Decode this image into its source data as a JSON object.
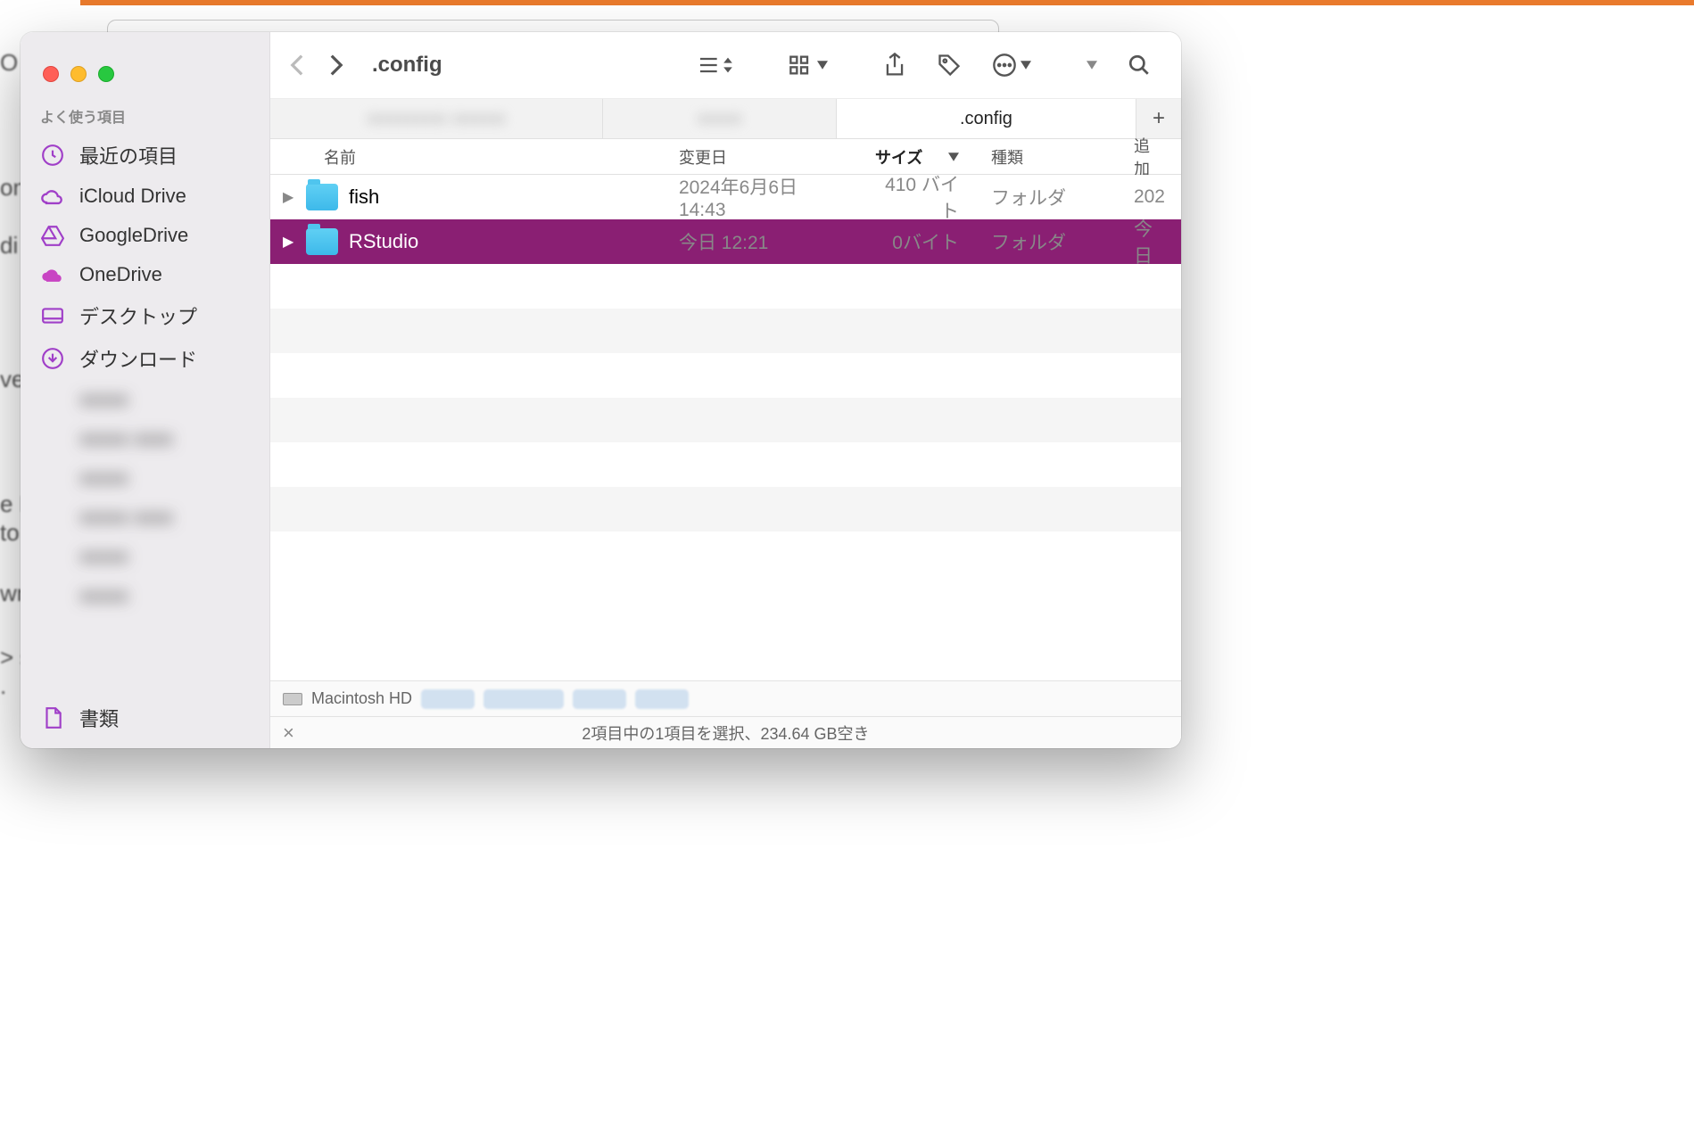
{
  "location_title": ".config",
  "sidebar": {
    "section_favorites": "よく使う項目",
    "items": [
      {
        "label": "最近の項目"
      },
      {
        "label": "iCloud Drive"
      },
      {
        "label": "GoogleDrive"
      },
      {
        "label": "OneDrive"
      },
      {
        "label": "デスクトップ"
      },
      {
        "label": "ダウンロード"
      }
    ],
    "bottom": {
      "label": "書類"
    }
  },
  "tabs": {
    "hidden1": "",
    "hidden2": "",
    "active": ".config"
  },
  "columns": {
    "name": "名前",
    "date": "変更日",
    "size": "サイズ",
    "kind": "種類",
    "added": "追加"
  },
  "rows": [
    {
      "name": "fish",
      "date": "2024年6月6日 14:43",
      "size": "410 バイト",
      "kind": "フォルダ",
      "added": "202",
      "selected": false
    },
    {
      "name": "RStudio",
      "date": "今日 12:21",
      "size": "0バイト",
      "kind": "フォルダ",
      "added": "今日",
      "selected": true
    }
  ],
  "pathbar": {
    "drive": "Macintosh HD"
  },
  "statusbar": "2項目中の1項目を選択、234.64 GB空き",
  "bg": {
    "t1": "O",
    "t2": "on",
    "t3": "di",
    "t4": "ve",
    "t5": "e R",
    "t6": "to",
    "t7": "wn",
    "t8": "> s",
    "t9": "."
  }
}
